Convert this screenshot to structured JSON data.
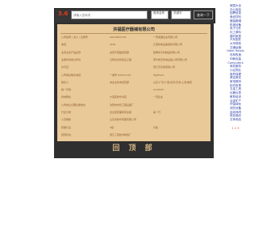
{
  "toolbar": {
    "logo": "3.6",
    "search_placeholder": "请输入查询词",
    "field2": "首用名称",
    "field3": "关键字",
    "query_label": "查询一下"
  },
  "company": {
    "title": "洪福医疗器械有限公司",
    "rows": [
      [
        "公司名称 / 法人 / 注册号",
        "AG0-8001231",
        "一带发展企业有限公司"
      ],
      [
        "电话",
        "0201",
        "江南机电设备销售有限公司"
      ],
      [
        "主营业务产品名称",
        "吉安平阳路经营部",
        "昆明市平科制品有限公司"
      ],
      [
        "注册时间成立年份",
        "云南省泰和建设工程",
        "南宁新农机电设备公司有限公司"
      ],
      [
        "许可证",
        "",
        "浙江乐泰和贸易公司"
      ],
      [
        "公司地址联系电话",
        "一番号 0318-2134",
        "TagPoem"
      ],
      [
        "联系人",
        "本企业的未经营部",
        "山东/广东/广西/北京/天津/上海/重庆"
      ],
      [
        "统一代码",
        "",
        "eco0022"
      ],
      [
        "商城网址",
        "大连区新华书店",
        "一流企业"
      ],
      [
        "公司成立日期注册地址",
        "沈阳市水利工程设备厂",
        ""
      ],
      [
        "行业分类",
        "企业经营面积营业额",
        "第一行"
      ],
      [
        "人员规模",
        "山东省新华家居有限公司",
        ""
      ],
      [
        "所属行业",
        "A级",
        "行政"
      ],
      [
        "经营状态",
        "浙江工贸技术制造厂",
        ""
      ]
    ],
    "footer": "回 顶 部"
  },
  "sidebar": {
    "links": [
      "家园大全",
      "办公用品",
      "招聘信息",
      "食品饮料",
      "服装鞋帽",
      "机械设备",
      "电子元件",
      "化工原料",
      "建材家居",
      "汽车配件",
      "大专院校",
      "交通运输",
      "Hotel Hotels",
      "农林牧渔",
      "印刷包装",
      "Computers",
      "商务服务",
      "小区物业",
      "医药保健",
      "美容美发",
      "家电数码",
      "纺织皮革",
      "五金工具",
      "仪器仪表",
      "教育培训",
      "冶金矿产",
      "环保绿化",
      "安防设备",
      "运动休闲",
      "旅游酒店",
      "文体用品"
    ],
    "bottom": "1 2 3"
  }
}
